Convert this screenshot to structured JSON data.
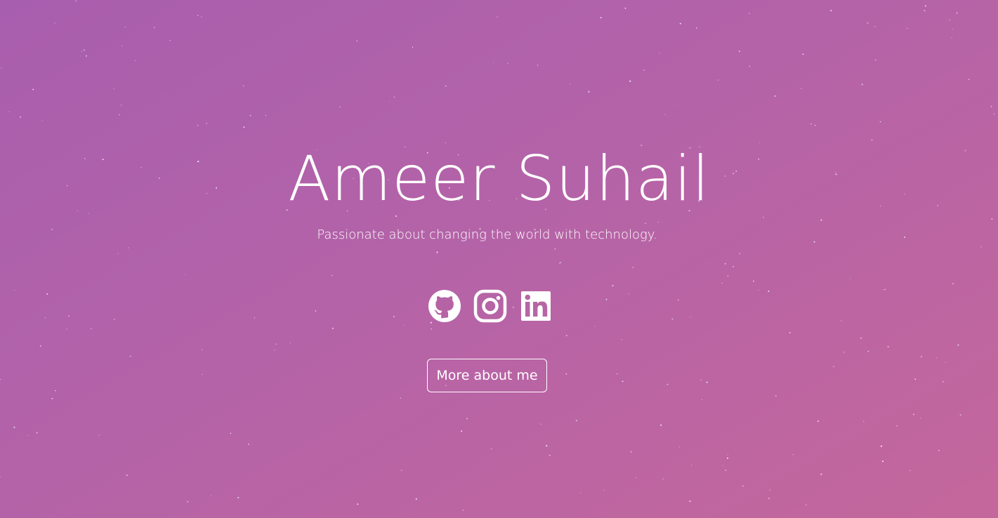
{
  "hero": {
    "name": "Ameer Suhail",
    "tagline": "Passionate about changing the world with technology.",
    "more_button_label": "More about me"
  },
  "socials": [
    {
      "name": "GitHub",
      "icon": "github-icon"
    },
    {
      "name": "Instagram",
      "icon": "instagram-icon"
    },
    {
      "name": "LinkedIn",
      "icon": "linkedin-icon"
    }
  ],
  "colors": {
    "background_start": "#a85eae",
    "background_end": "#c4679c",
    "foreground": "#ffffff"
  }
}
